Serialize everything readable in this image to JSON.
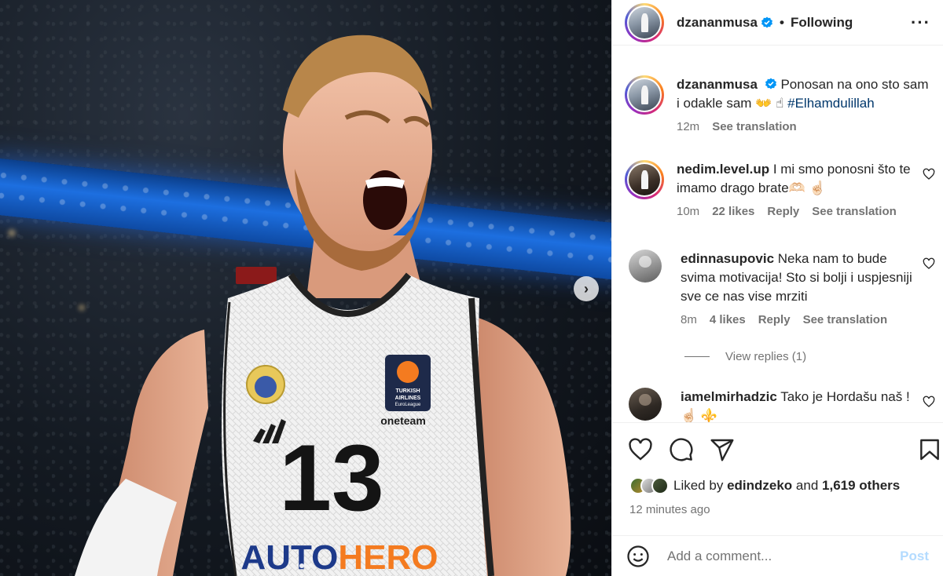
{
  "header": {
    "username": "dzananmusa",
    "separator": "•",
    "follow_status": "Following",
    "more_icon": "more-horizontal-icon"
  },
  "caption": {
    "username": "dzananmusa",
    "text": "Ponosan na ono sto sam i odakle sam 👐 ☝",
    "hashtag": "#Elhamdulillah",
    "time": "12m",
    "see_translation": "See translation"
  },
  "comments": [
    {
      "username": "nedim.level.up",
      "text": "I mi smo ponosni što te imamo drago brate🫶🏻 ☝🏻",
      "time": "10m",
      "likes": "22 likes",
      "reply": "Reply",
      "see_translation": "See translation"
    },
    {
      "username": "edinnasupovic",
      "text": "Neka nam to bude svima motivacija! Sto si bolji i uspjesniji sve ce nas vise mrziti",
      "time": "8m",
      "likes": "4 likes",
      "reply": "Reply",
      "see_translation": "See translation",
      "view_replies": "View replies (1)"
    },
    {
      "username": "iamelmirhadzic",
      "text": "Tako je Hordašu naš ! ☝🏻 ⚜️"
    }
  ],
  "likes": {
    "prefix": "Liked by",
    "user": "edindzeko",
    "joiner": "and",
    "others": "1,619 others"
  },
  "post_time": "12 minutes ago",
  "add_comment": {
    "placeholder": "Add a comment...",
    "post_label": "Post"
  },
  "media": {
    "jersey_number": "13",
    "sponsor": "AUTOHERO",
    "brand": "oneteam",
    "league_badge": "TURKISH AIRLINES EuroLeague"
  },
  "colors": {
    "verified": "#0095f6",
    "link": "#00376b",
    "muted": "#737373",
    "post_disabled": "#b3dbff",
    "sponsor_orange": "#f47b20",
    "sponsor_blue": "#1d3a8a"
  }
}
